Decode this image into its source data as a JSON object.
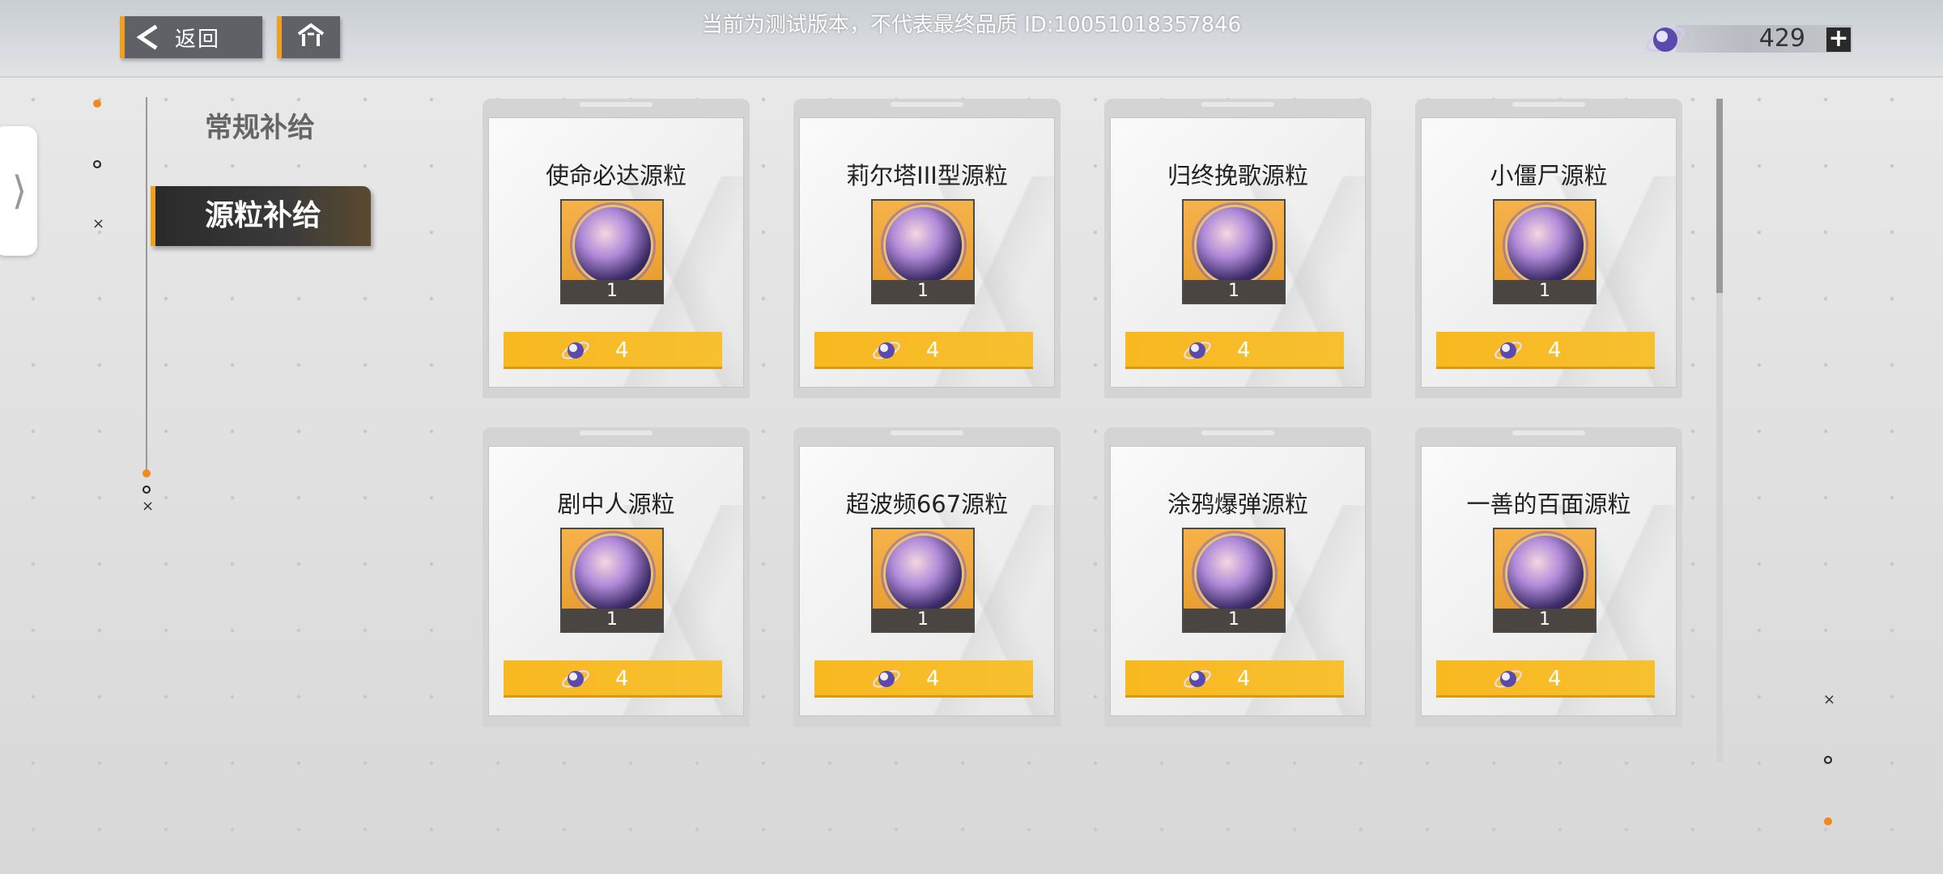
{
  "header": {
    "back_label": "返回",
    "version_notice": "当前为测试版本，不代表最终品质 ID:10051018357846"
  },
  "currency": {
    "amount": "429",
    "plus_label": "+",
    "icon": "crystal-gem-icon"
  },
  "sidebar": {
    "tabs": [
      {
        "label": "常规补给",
        "active": false
      },
      {
        "label": "源粒补给",
        "active": true
      }
    ]
  },
  "colors": {
    "accent": "#f0a020",
    "price_bar": "#f8b820",
    "active_tab": "#2a2a2a"
  },
  "shop": {
    "items": [
      {
        "name": "使命必达源粒",
        "quantity": "1",
        "price": "4"
      },
      {
        "name": "莉尔塔III型源粒",
        "quantity": "1",
        "price": "4"
      },
      {
        "name": "归终挽歌源粒",
        "quantity": "1",
        "price": "4"
      },
      {
        "name": "小僵尸源粒",
        "quantity": "1",
        "price": "4"
      },
      {
        "name": "剧中人源粒",
        "quantity": "1",
        "price": "4"
      },
      {
        "name": "超波频667源粒",
        "quantity": "1",
        "price": "4"
      },
      {
        "name": "涂鸦爆弹源粒",
        "quantity": "1",
        "price": "4"
      },
      {
        "name": "一善的百面源粒",
        "quantity": "1",
        "price": "4"
      }
    ]
  }
}
